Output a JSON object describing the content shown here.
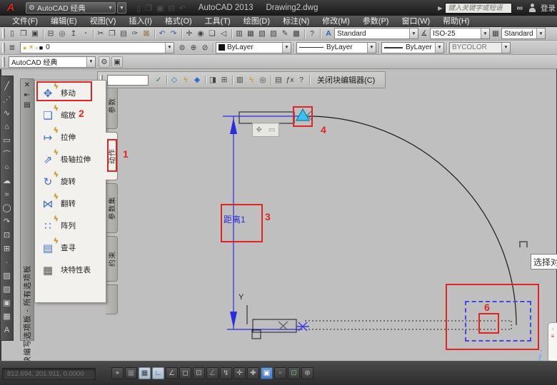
{
  "title_bar": {
    "logo_glyph": "A",
    "workspace_value": "AutoCAD 经典",
    "app_title": "AutoCAD 2013",
    "doc_title": "Drawing2.dwg",
    "flyout_glyph": "▶",
    "search_placeholder": "键入关键字或短语",
    "binoculars_glyph": "∞",
    "sign_in_label": "登录",
    "qat_icons": [
      {
        "name": "qat-new-icon",
        "glyph": "▯"
      },
      {
        "name": "qat-open-icon",
        "glyph": "❒"
      },
      {
        "name": "qat-save-icon",
        "glyph": "▣"
      },
      {
        "name": "qat-plot-icon",
        "glyph": "⊟"
      },
      {
        "name": "qat-undo-icon",
        "glyph": "↶"
      }
    ]
  },
  "menu_bar": {
    "items": [
      {
        "name": "menu-file",
        "label": "文件(F)"
      },
      {
        "name": "menu-edit",
        "label": "编辑(E)"
      },
      {
        "name": "menu-view",
        "label": "视图(V)"
      },
      {
        "name": "menu-insert",
        "label": "插入(I)"
      },
      {
        "name": "menu-format",
        "label": "格式(O)"
      },
      {
        "name": "menu-tools",
        "label": "工具(T)"
      },
      {
        "name": "menu-draw",
        "label": "绘图(D)"
      },
      {
        "name": "menu-dimension",
        "label": "标注(N)"
      },
      {
        "name": "menu-modify",
        "label": "修改(M)"
      },
      {
        "name": "menu-parametric",
        "label": "参数(P)"
      },
      {
        "name": "menu-window",
        "label": "窗口(W)"
      },
      {
        "name": "menu-help",
        "label": "帮助(H)"
      }
    ]
  },
  "standard_toolbar": {
    "icons": [
      {
        "name": "new-icon",
        "glyph": "▯"
      },
      {
        "name": "open-icon",
        "glyph": "❒"
      },
      {
        "name": "save-icon",
        "glyph": "▣"
      },
      {
        "divider": true
      },
      {
        "name": "plot-icon",
        "glyph": "⊟"
      },
      {
        "name": "plot-preview-icon",
        "glyph": "◎"
      },
      {
        "name": "publish-icon",
        "glyph": "↥"
      },
      {
        "name": "3d-dwf-icon",
        "glyph": "◔",
        "color": "#8a6a2a"
      },
      {
        "divider": true
      },
      {
        "name": "cut-icon",
        "glyph": "✂"
      },
      {
        "name": "copy-icon",
        "glyph": "❐"
      },
      {
        "name": "paste-icon",
        "glyph": "▤"
      },
      {
        "name": "match-properties-icon",
        "glyph": "✑"
      },
      {
        "name": "block-editor-icon",
        "glyph": "⊠",
        "color": "#96662a"
      },
      {
        "divider": true
      },
      {
        "name": "undo-icon",
        "glyph": "↶",
        "color": "#3a5fa8"
      },
      {
        "name": "redo-icon",
        "glyph": "↷",
        "color": "#3a5fa8"
      },
      {
        "divider": true
      },
      {
        "name": "pan-icon",
        "glyph": "✛"
      },
      {
        "name": "zoom-realtime-icon",
        "glyph": "◉"
      },
      {
        "name": "zoom-window-icon",
        "glyph": "❏"
      },
      {
        "name": "zoom-previous-icon",
        "glyph": "◁"
      },
      {
        "divider": true
      },
      {
        "name": "properties-icon",
        "glyph": "▥"
      },
      {
        "name": "designcenter-icon",
        "glyph": "▦"
      },
      {
        "name": "tool-palettes-icon",
        "glyph": "▧"
      },
      {
        "name": "sheet-set-manager-icon",
        "glyph": "▨"
      },
      {
        "name": "markup-set-manager-icon",
        "glyph": "✎"
      },
      {
        "name": "quickcalc-icon",
        "glyph": "▩"
      },
      {
        "divider": true
      },
      {
        "name": "help-icon",
        "glyph": "?"
      }
    ]
  },
  "styles_toolbar": {
    "text_style_icon": "A",
    "text_style": "Standard",
    "dim_style_icon": "∡",
    "dim_style": "ISO-25",
    "table_style_icon": "▦",
    "table_style": "Standard"
  },
  "layers_toolbar": {
    "layer_props_icon": "≣",
    "combo_icons": [
      {
        "name": "bulb-icon",
        "glyph": "●",
        "color": "#e2b820"
      },
      {
        "name": "sun-icon",
        "glyph": "☀",
        "color": "#e2a010"
      },
      {
        "name": "lock-icon",
        "glyph": "▫",
        "color": "#777777"
      },
      {
        "name": "layer-swatch-icon",
        "glyph": "■",
        "color": "#111111"
      }
    ],
    "layer_name": "0",
    "aux_icons": [
      {
        "name": "make-object-layer-icon",
        "glyph": "⊜"
      },
      {
        "name": "layer-states-icon",
        "glyph": "⊕"
      },
      {
        "name": "layer-previous-icon",
        "glyph": "⊘"
      }
    ]
  },
  "properties_toolbar": {
    "color": "ByLayer",
    "linetype": "ByLayer",
    "lineweight": "ByLayer",
    "plot_style": "BYCOLOR"
  },
  "workspace_toolbar": {
    "value": "AutoCAD 经典",
    "gear_icon": "⚙",
    "settings_icon": "▣"
  },
  "block_editor_toolbar": {
    "field_value": "",
    "icons": [
      {
        "name": "save-block-icon",
        "glyph": "✓",
        "color": "#2e7d32"
      },
      {
        "divider": true
      },
      {
        "name": "parameter-icon",
        "glyph": "◇",
        "color": "#2a6fd0"
      },
      {
        "name": "action-icon",
        "glyph": "ϟ",
        "color": "#d09000"
      },
      {
        "name": "parameter-set-icon",
        "glyph": "◆",
        "color": "#2a6fd0"
      },
      {
        "divider": true
      },
      {
        "name": "attribute-definition-icon",
        "glyph": "◨",
        "color": "#444444"
      },
      {
        "name": "block-table-icon",
        "glyph": "⊞",
        "color": "#444444"
      },
      {
        "divider": true
      },
      {
        "name": "authoring-palettes-icon",
        "glyph": "▥",
        "color": "#444444"
      },
      {
        "name": "action-parameters-icon",
        "glyph": "ϟ",
        "color": "#d09000"
      },
      {
        "name": "visibility-icon",
        "glyph": "◎",
        "color": "#444444"
      },
      {
        "divider": true
      },
      {
        "name": "parameter-manager-icon",
        "glyph": "▤",
        "color": "#444444"
      },
      {
        "name": "fx-icon",
        "glyph": "ƒx",
        "color": "#444444"
      },
      {
        "name": "block-help-icon",
        "glyph": "?",
        "color": "#444444"
      }
    ],
    "close_label": "关闭块编辑器(C)"
  },
  "draw_toolbar": {
    "icons": [
      {
        "name": "line-icon",
        "glyph": "╱"
      },
      {
        "name": "construction-line-icon",
        "glyph": "⋰"
      },
      {
        "name": "polyline-icon",
        "glyph": "∿"
      },
      {
        "name": "polygon-icon",
        "glyph": "⌂"
      },
      {
        "name": "rectangle-icon",
        "glyph": "▭"
      },
      {
        "name": "arc-icon",
        "glyph": "⌒"
      },
      {
        "name": "circle-icon",
        "glyph": "○"
      },
      {
        "name": "revision-cloud-icon",
        "glyph": "☁"
      },
      {
        "name": "spline-icon",
        "glyph": "≈"
      },
      {
        "name": "ellipse-icon",
        "glyph": "◯"
      },
      {
        "name": "ellipse-arc-icon",
        "glyph": "↷"
      },
      {
        "name": "insert-block-icon",
        "glyph": "⊡"
      },
      {
        "name": "make-block-icon",
        "glyph": "⊞"
      },
      {
        "name": "point-icon",
        "glyph": "∙"
      },
      {
        "name": "hatch-icon",
        "glyph": "▨"
      },
      {
        "name": "gradient-icon",
        "glyph": "▧"
      },
      {
        "name": "region-icon",
        "glyph": "▣"
      },
      {
        "name": "table-icon",
        "glyph": "▦"
      },
      {
        "name": "mtext-icon",
        "glyph": "A"
      }
    ]
  },
  "palette": {
    "title": "块编写选项板 - 所有选项板",
    "close_icon": "✕",
    "autohide_icon": "⇤",
    "menu_icon": "▤",
    "bolt_glyph": "ϟ",
    "items": [
      {
        "name": "palette-item-move",
        "glyph": "✥",
        "label": "移动"
      },
      {
        "name": "palette-item-scale",
        "glyph": "❏",
        "label": "缩放"
      },
      {
        "name": "palette-item-stretch",
        "glyph": "↦",
        "label": "拉伸"
      },
      {
        "name": "palette-item-polar-stretch",
        "glyph": "⇗",
        "label": "极轴拉伸"
      },
      {
        "name": "palette-item-rotate",
        "glyph": "↻",
        "label": "旋转"
      },
      {
        "name": "palette-item-flip",
        "glyph": "⋈",
        "label": "翻转"
      },
      {
        "name": "palette-item-array",
        "glyph": "∷",
        "label": "阵列"
      },
      {
        "name": "palette-item-lookup",
        "glyph": "▤",
        "label": "查寻"
      },
      {
        "name": "palette-item-block-table",
        "glyph": "▦",
        "label": "块特性表",
        "cls": "no-bolt"
      }
    ],
    "tabs": [
      {
        "name": "tab-parameters",
        "label": "参数"
      },
      {
        "name": "tab-actions",
        "label": "动作"
      },
      {
        "name": "tab-parameter-sets",
        "label": "参数集"
      },
      {
        "name": "tab-constraints",
        "label": "约束"
      }
    ]
  },
  "canvas": {
    "dimension_label": "距离1",
    "axis_label": "Y",
    "tooltip_text": "选择对象"
  },
  "callouts": {
    "s1": "1",
    "s2": "2",
    "s3": "3",
    "s4": "4",
    "s6": "6"
  },
  "status_bar": {
    "coordinates": "812.694, 201.911, 0.0000",
    "buttons": [
      {
        "name": "infer-constraints-toggle",
        "glyph": "⌖"
      },
      {
        "name": "snap-mode-toggle",
        "glyph": "▦",
        "cls": "pale"
      },
      {
        "name": "grid-display-toggle",
        "glyph": "▦",
        "cls": "pressed"
      },
      {
        "name": "ortho-mode-toggle",
        "glyph": "∟",
        "cls": "pressed",
        "color": "#1d4fc0"
      },
      {
        "name": "polar-tracking-toggle",
        "glyph": "∠"
      },
      {
        "name": "object-snap-toggle",
        "glyph": "◻"
      },
      {
        "name": "3d-object-snap-toggle",
        "glyph": "⊡"
      },
      {
        "name": "object-snap-tracking-toggle",
        "glyph": "∠",
        "cls": "pale"
      },
      {
        "name": "dynamic-ucs-toggle",
        "glyph": "↯"
      },
      {
        "name": "dynamic-input-toggle",
        "glyph": "✛"
      },
      {
        "name": "lineweight-toggle",
        "glyph": "✚"
      },
      {
        "name": "transparency-toggle",
        "glyph": "▣",
        "cls": "pressed-blue"
      },
      {
        "name": "quick-properties-toggle",
        "glyph": "▫"
      },
      {
        "name": "selection-cycling-toggle",
        "glyph": "⊡",
        "color": "#79b379"
      },
      {
        "name": "annotation-monitor-toggle",
        "glyph": "⊕"
      }
    ]
  },
  "watermark": "j",
  "colors": {
    "callout_red": "#e02424",
    "dimension_blue": "#2b2be0",
    "selection_blue": "#4747e2",
    "grip_cyan": "#3fc1f0"
  }
}
